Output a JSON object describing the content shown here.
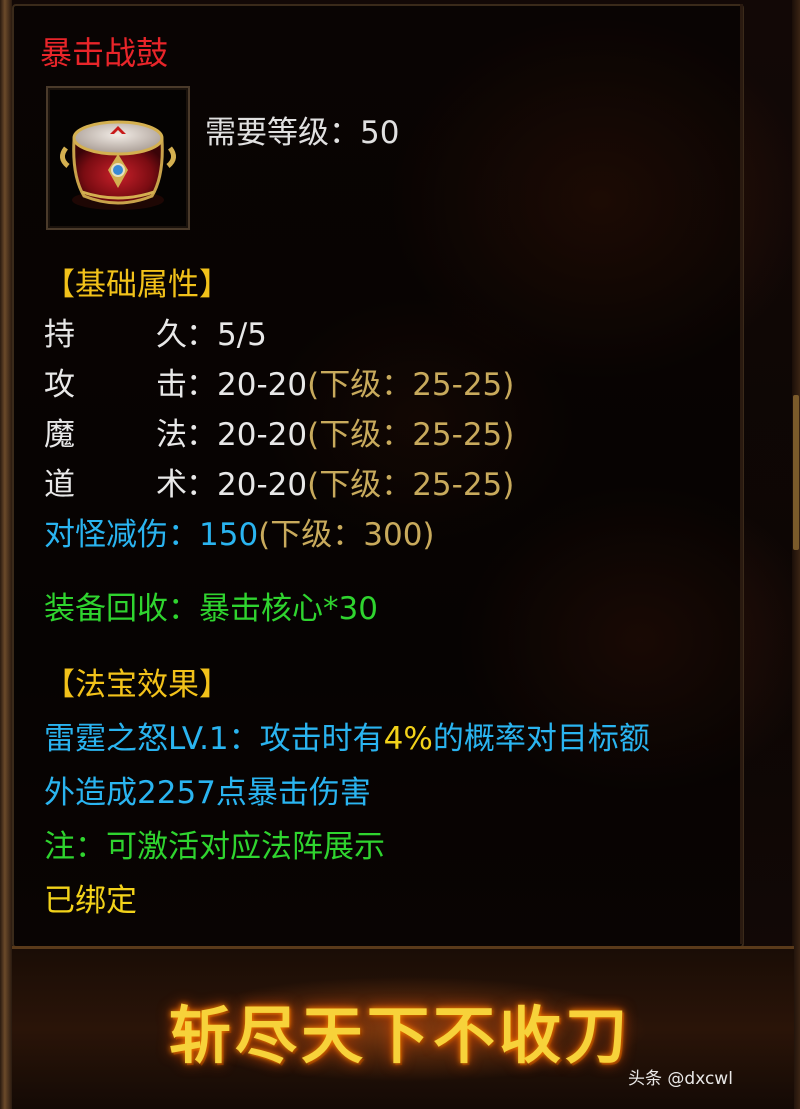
{
  "item": {
    "name": "暴击战鼓",
    "required_level": "需要等级：50"
  },
  "base_attributes": {
    "header": "【基础属性】",
    "rows": [
      {
        "l1": "持",
        "l2": "久",
        "value": "：5/5",
        "next": ""
      },
      {
        "l1": "攻",
        "l2": "击",
        "value": "：20-20",
        "next": "(下级：25-25)"
      },
      {
        "l1": "魔",
        "l2": "法",
        "value": "：20-20",
        "next": "(下级：25-25)"
      },
      {
        "l1": "道",
        "l2": "术",
        "value": "：20-20",
        "next": "(下级：25-25)"
      }
    ],
    "damage_reduction": {
      "label": "对怪减伤",
      "value": "：150",
      "next": "(下级：300)"
    }
  },
  "recycle": "装备回收：暴击核心*30",
  "magic_effect": {
    "header": "【法宝效果】",
    "line1_a": "雷霆之怒LV.1：攻击时有",
    "line1_b": "4%",
    "line1_c": "的概率对目标额",
    "line2": "外造成2257点暴击伤害"
  },
  "note": "注：可激活对应法阵展示",
  "bound": "已绑定",
  "banner": "斩尽天下不收刀",
  "watermark": "头条 @dxcwl",
  "colors": {
    "name": "#e8252a",
    "header": "#f2c21a",
    "next_level": "#c8aa5c",
    "blue_stat": "#2ab4f0",
    "green": "#2fd42f"
  }
}
